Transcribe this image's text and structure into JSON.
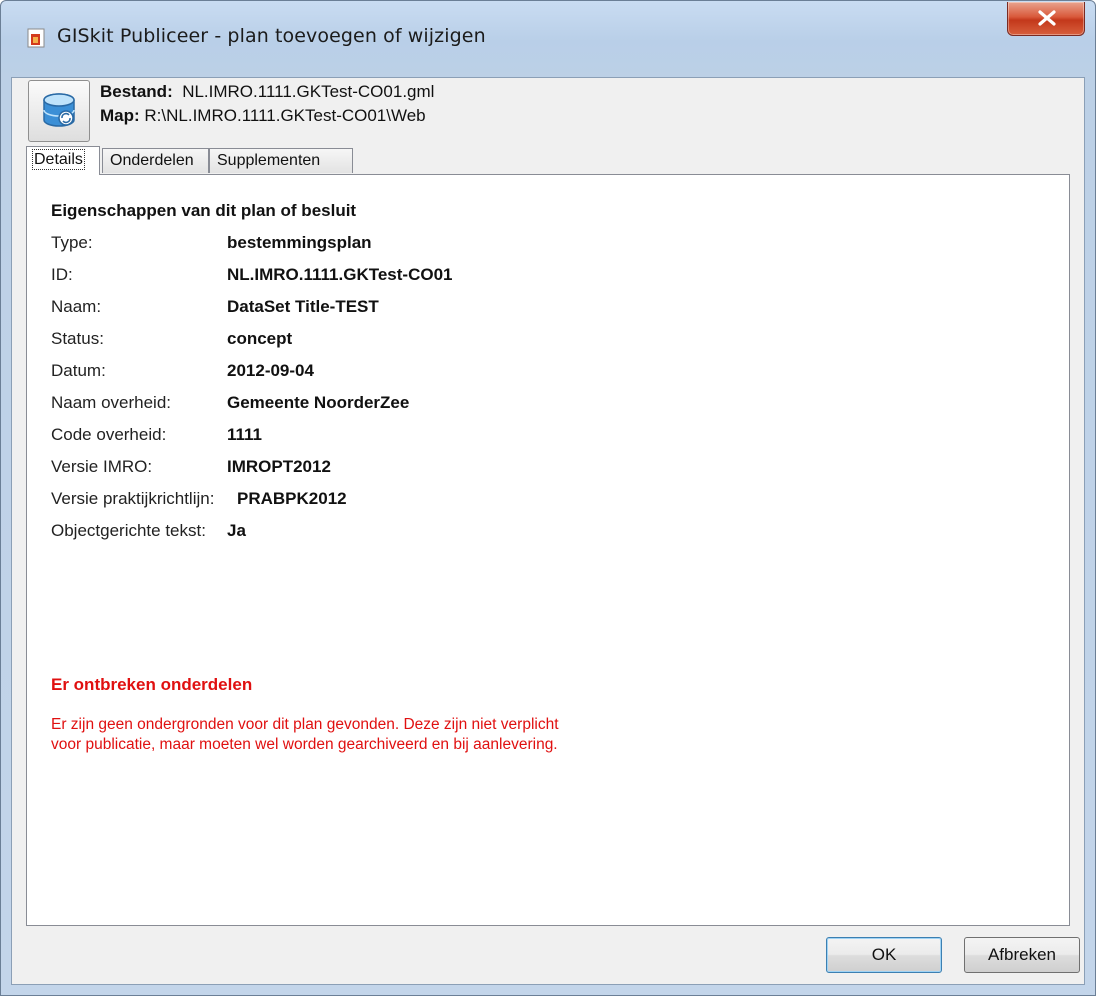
{
  "window": {
    "title": "GISkit Publiceer - plan toevoegen of wijzigen"
  },
  "file": {
    "bestand_label": "Bestand:",
    "bestand_value": "NL.IMRO.1111.GKTest-CO01.gml",
    "map_label": "Map:",
    "map_value": "R:\\NL.IMRO.1111.GKTest-CO01\\Web"
  },
  "tabs": [
    {
      "label": "Details"
    },
    {
      "label": "Onderdelen"
    },
    {
      "label": "Supplementen"
    }
  ],
  "details": {
    "section_title": "Eigenschappen van dit plan of besluit",
    "properties": [
      {
        "label": "Type:",
        "value": "bestemmingsplan"
      },
      {
        "label": "ID:",
        "value": "NL.IMRO.1111.GKTest-CO01"
      },
      {
        "label": "Naam:",
        "value": "DataSet Title-TEST"
      },
      {
        "label": "Status:",
        "value": "concept"
      },
      {
        "label": "Datum:",
        "value": "2012-09-04"
      },
      {
        "label": "Naam overheid:",
        "value": "Gemeente NoorderZee"
      },
      {
        "label": "Code overheid:",
        "value": "1111"
      },
      {
        "label": "Versie IMRO:",
        "value": "IMROPT2012"
      },
      {
        "label": "Versie praktijkrichtlijn:",
        "value": "PRABPK2012"
      },
      {
        "label": "Objectgerichte tekst:",
        "value": "Ja"
      }
    ],
    "warning_title": "Er ontbreken onderdelen",
    "warning_line1": "Er zijn geen ondergronden voor dit plan gevonden. Deze zijn niet verplicht",
    "warning_line2": "voor publicatie, maar moeten wel worden gearchiveerd en bij aanlevering."
  },
  "buttons": {
    "ok": "OK",
    "cancel": "Afbreken"
  },
  "colors": {
    "warning": "#e01010",
    "close_button": "#c94a2e"
  }
}
